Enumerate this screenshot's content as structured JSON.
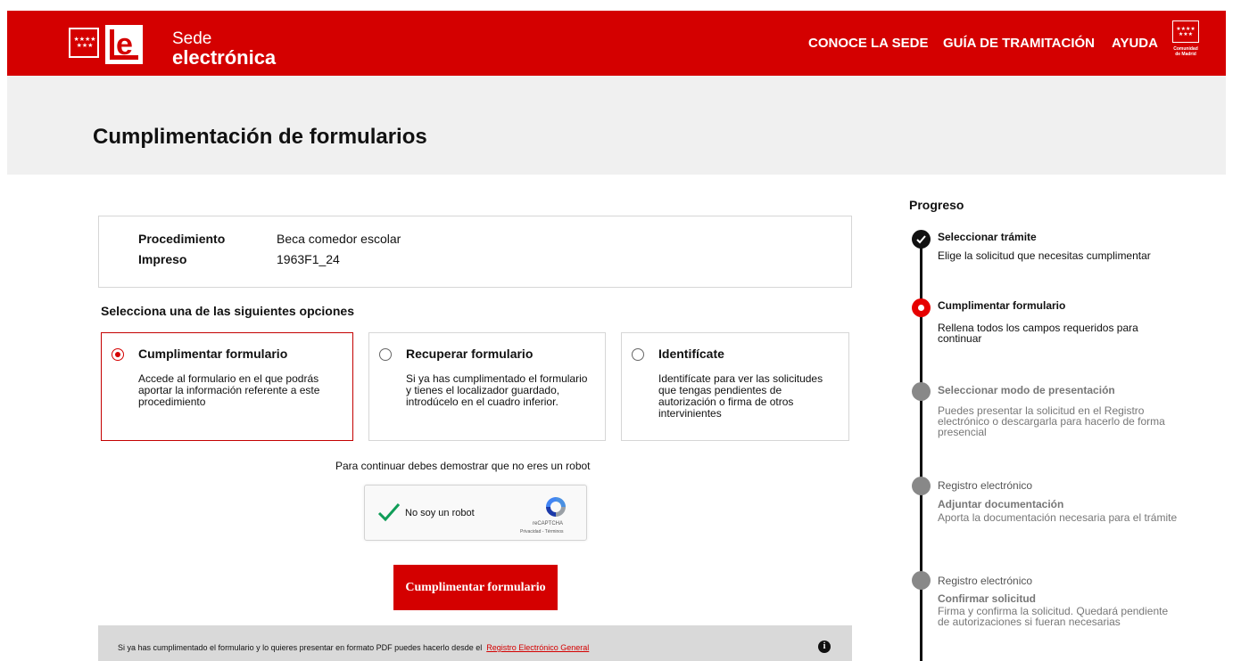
{
  "header": {
    "logo_line1": "Sede",
    "logo_line2": "electrónica",
    "nav": [
      "CONOCE LA SEDE",
      "GUÍA DE TRAMITACIÓN",
      "AYUDA"
    ],
    "region_logo_label1": "Comunidad",
    "region_logo_label2": "de Madrid",
    "brand_color": "#d40000"
  },
  "page_title": "Cumplimentación de formularios",
  "info": {
    "procedimiento_label": "Procedimiento",
    "procedimiento_value": "Beca comedor escolar",
    "impreso_label": "Impreso",
    "impreso_value": "1963F1_24"
  },
  "select_heading": "Selecciona una de las siguientes opciones",
  "options": [
    {
      "title": "Cumplimentar formulario",
      "desc": "Accede al formulario en el que podrás aportar la información referente a este procedimiento",
      "selected": true
    },
    {
      "title": "Recuperar formulario",
      "desc": "Si ya has cumplimentado el formulario y tienes el localizador guardado, introdúcelo en el cuadro inferior.",
      "selected": false
    },
    {
      "title": "Identifícate",
      "desc": "Identifícate para ver las solicitudes que tengas pendientes de autorización o firma de otros intervinientes",
      "selected": false
    }
  ],
  "robot_text": "Para continuar debes demostrar que no eres un robot",
  "captcha": {
    "label": "No soy un robot",
    "brand": "reCAPTCHA",
    "links": "Privacidad - Términos",
    "checked": true
  },
  "submit_label": "Cumplimentar formulario",
  "footer_note": {
    "text": "Si ya has cumplimentado el formulario y lo quieres presentar en formato PDF puedes hacerlo desde el",
    "link": "Registro Electrónico General",
    "info_icon": "i"
  },
  "progress": {
    "title": "Progreso",
    "steps": [
      {
        "status": "done",
        "title": "Seleccionar trámite",
        "desc": "Elige la solicitud que necesitas cumplimentar"
      },
      {
        "status": "current",
        "title": "Cumplimentar formulario",
        "desc": "Rellena todos los campos requeridos para continuar"
      },
      {
        "status": "pending",
        "title": "Seleccionar modo de presentación",
        "desc": "Puedes presentar la solicitud en el Registro electrónico o descargarla para hacerlo de forma presencial"
      },
      {
        "status": "pending",
        "sub": "Registro electrónico",
        "title": "Adjuntar documentación",
        "desc": "Aporta la documentación necesaria para el trámite"
      },
      {
        "status": "pending",
        "sub": "Registro electrónico",
        "title": "Confirmar solicitud",
        "desc": "Firma y confirma la solicitud. Quedará pendiente de autorizaciones si fueran necesarias"
      }
    ]
  }
}
